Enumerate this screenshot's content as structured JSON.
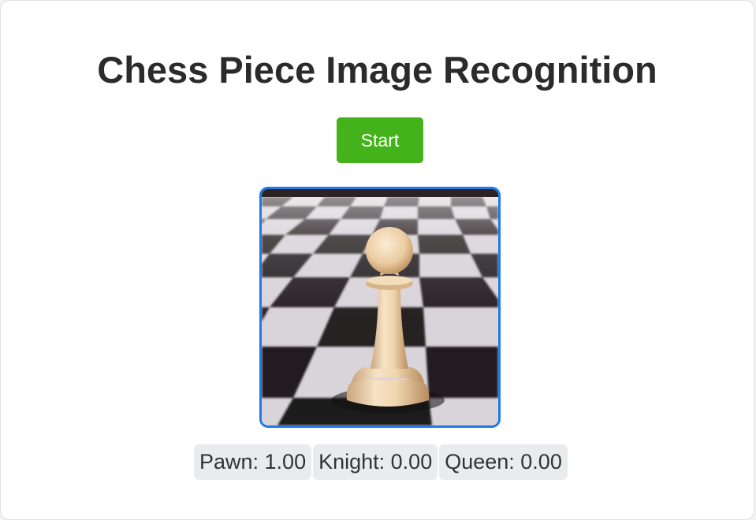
{
  "page": {
    "title": "Chess Piece Image Recognition",
    "start_label": "Start"
  },
  "camera": {
    "subject": "pawn",
    "description_icon": "chess-pawn-photo"
  },
  "predictions": [
    {
      "label": "Pawn: 1.00"
    },
    {
      "label": "Knight: 0.00"
    },
    {
      "label": "Queen: 0.00"
    }
  ],
  "colors": {
    "accent_green": "#44b21a",
    "frame_blue": "#1f7ae6",
    "chip_bg": "#e9ebee"
  }
}
